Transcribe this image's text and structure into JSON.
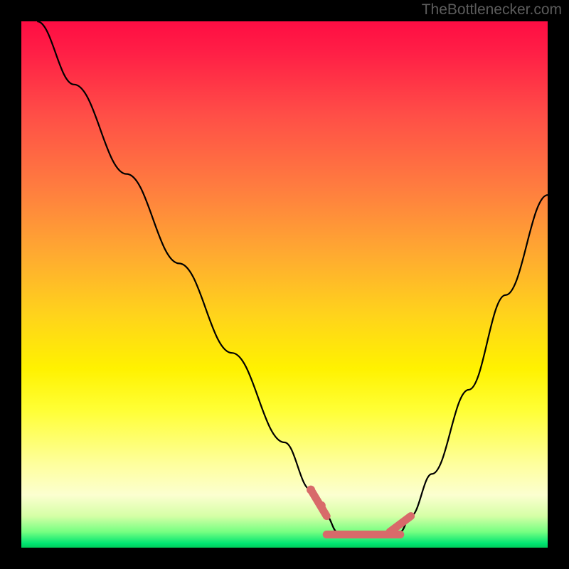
{
  "attribution": "TheBottlenecker.com",
  "chart_data": {
    "type": "line",
    "title": "",
    "xlabel": "",
    "ylabel": "",
    "xlim": [
      0,
      100
    ],
    "ylim": [
      0,
      100
    ],
    "series": [
      {
        "name": "curve",
        "x": [
          3,
          10,
          20,
          30,
          40,
          50,
          55,
          58,
          60,
          62,
          66,
          70,
          72,
          74,
          78,
          85,
          92,
          100
        ],
        "y": [
          100,
          88,
          71,
          54,
          37,
          20,
          11,
          6,
          3,
          2,
          2,
          2,
          3,
          6,
          14,
          30,
          48,
          67
        ]
      }
    ],
    "highlight_segments": [
      {
        "x": [
          55,
          58
        ],
        "y": [
          11,
          6
        ]
      },
      {
        "x": [
          58,
          72
        ],
        "y": [
          2.5,
          2.5
        ]
      },
      {
        "x": [
          70,
          74
        ],
        "y": [
          3,
          6
        ]
      }
    ],
    "highlight_points": [
      {
        "x": 55,
        "y": 11
      },
      {
        "x": 57,
        "y": 8
      }
    ],
    "colors": {
      "curve": "#000000",
      "highlight": "#d86a6a",
      "background_top": "#ff0d43",
      "background_bottom": "#00cc5a"
    }
  }
}
